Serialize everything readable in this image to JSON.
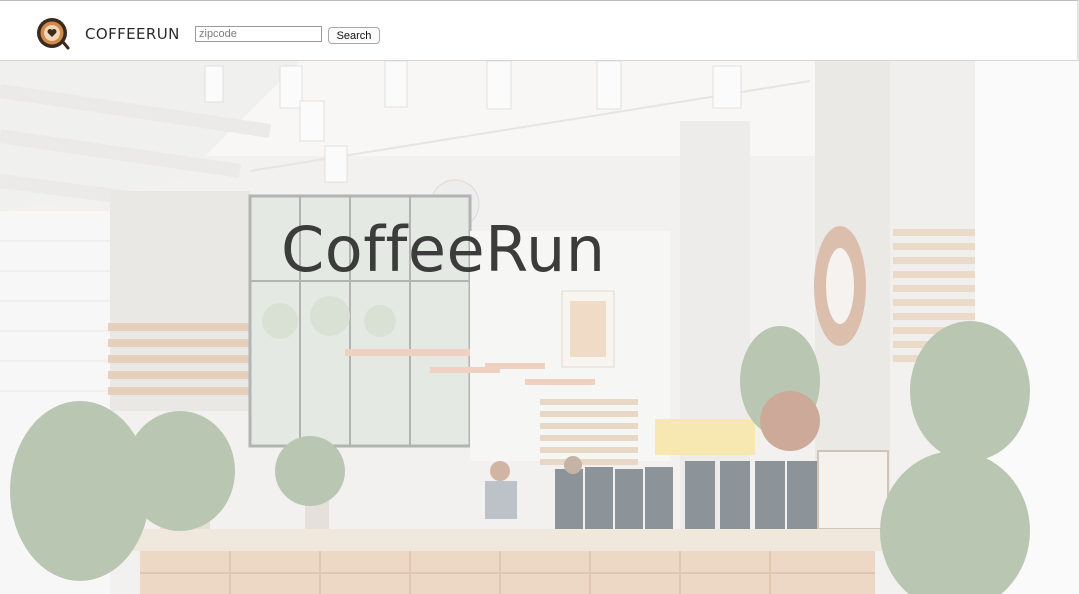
{
  "header": {
    "brand": "COFFEERUN",
    "search": {
      "placeholder": "zipcode",
      "value": "",
      "button_label": "Search"
    }
  },
  "hero": {
    "title": "CoffeeRun"
  },
  "colors": {
    "logo_ring": "#3a2a20",
    "logo_fill": "#d18a4a",
    "title": "#3c3c3c"
  }
}
